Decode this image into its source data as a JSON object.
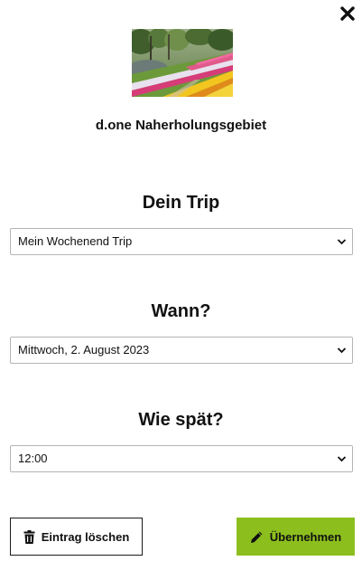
{
  "place": {
    "name": "d.one Naherholungsgebiet",
    "image_icon": "tulip-garden-photo"
  },
  "close": {
    "icon": "close-icon"
  },
  "trip": {
    "title": "Dein Trip",
    "selected": "Mein Wochenend Trip"
  },
  "when": {
    "title": "Wann?",
    "selected": "Mittwoch, 2. August 2023"
  },
  "time": {
    "title": "Wie spät?",
    "selected": "12:00"
  },
  "actions": {
    "delete_label": "Eintrag löschen",
    "delete_icon": "trash-icon",
    "apply_label": "Übernehmen",
    "apply_icon": "pencil-icon",
    "apply_color": "#8cbf1e"
  }
}
